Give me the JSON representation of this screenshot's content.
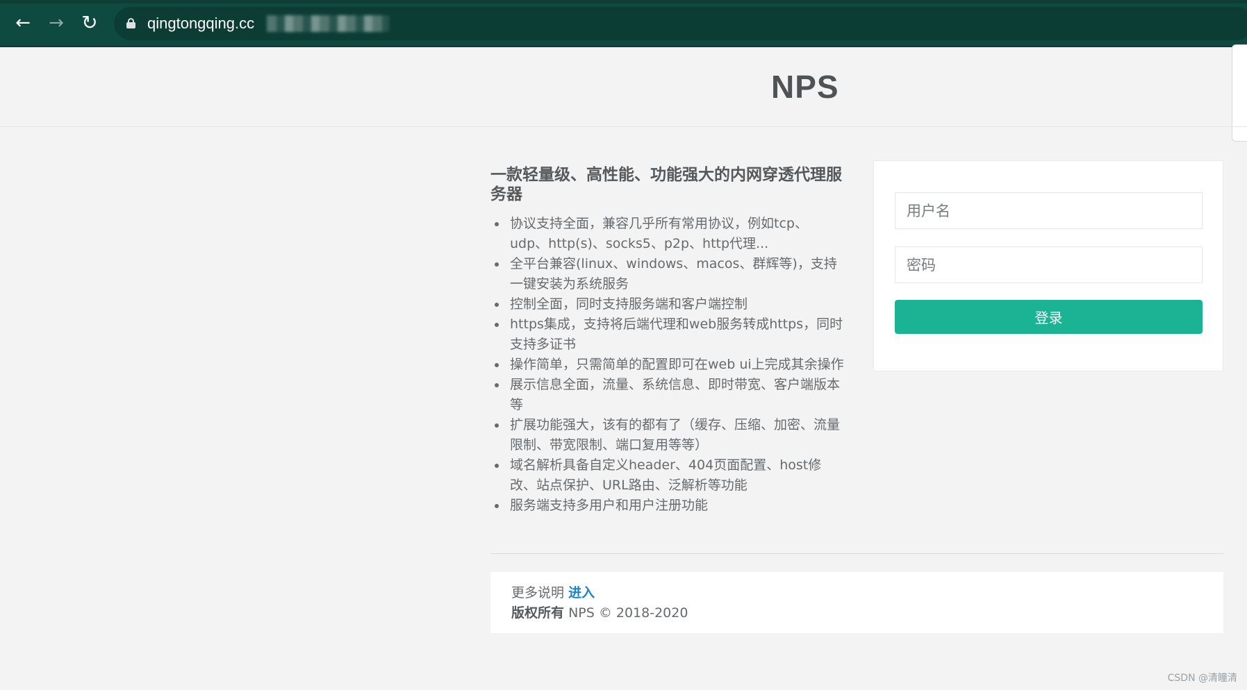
{
  "browser": {
    "url": "qingtongqing.cc",
    "back_icon": "←",
    "forward_icon": "→",
    "reload_icon": "↻"
  },
  "header": {
    "brand": "NPS"
  },
  "intro": {
    "title": "一款轻量级、高性能、功能强大的内网穿透代理服务器",
    "features": [
      "协议支持全面，兼容几乎所有常用协议，例如tcp、udp、http(s)、socks5、p2p、http代理...",
      "全平台兼容(linux、windows、macos、群辉等)，支持一键安装为系统服务",
      "控制全面，同时支持服务端和客户端控制",
      "https集成，支持将后端代理和web服务转成https，同时支持多证书",
      "操作简单，只需简单的配置即可在web ui上完成其余操作",
      "展示信息全面，流量、系统信息、即时带宽、客户端版本等",
      "扩展功能强大，该有的都有了（缓存、压缩、加密、流量限制、带宽限制、端口复用等等）",
      "域名解析具备自定义header、404页面配置、host修改、站点保护、URL路由、泛解析等功能",
      "服务端支持多用户和用户注册功能"
    ]
  },
  "login": {
    "username_placeholder": "用户名",
    "password_placeholder": "密码",
    "submit_label": "登录"
  },
  "footer": {
    "more_text": "更多说明",
    "more_link": "进入",
    "copyright_label": "版权所有",
    "copyright_text": "NPS © 2018-2020"
  },
  "watermark": "CSDN @清瞳清",
  "colors": {
    "accent": "#1ab394",
    "link": "#1c84c6",
    "browser_bar": "#0f4a40"
  }
}
